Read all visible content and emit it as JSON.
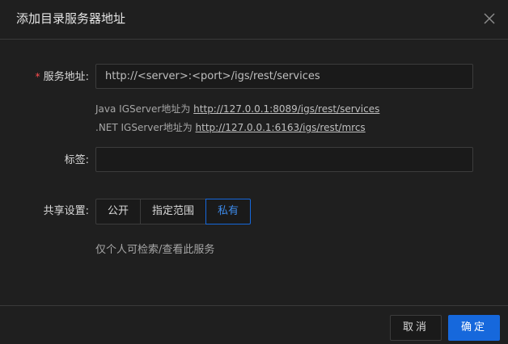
{
  "dialog": {
    "title": "添加目录服务器地址",
    "close_icon": "close-icon"
  },
  "form": {
    "service_address": {
      "required_mark": "*",
      "label": "服务地址:",
      "value": "http://<server>:<port>/igs/rest/services"
    },
    "hints": {
      "java_prefix": "Java IGServer地址为 ",
      "java_url": "http://127.0.0.1:8089/igs/rest/services",
      "net_prefix": ".NET IGServer地址为 ",
      "net_url": "http://127.0.0.1:6163/igs/rest/mrcs"
    },
    "tag": {
      "label": "标签:",
      "value": ""
    },
    "share": {
      "label": "共享设置:",
      "options": [
        "公开",
        "指定范围",
        "私有"
      ],
      "selected": "私有",
      "description": "仅个人可检索/查看此服务"
    }
  },
  "footer": {
    "cancel_label": "取消",
    "ok_label": "确定"
  },
  "colors": {
    "background": "#1f1f1f",
    "primary": "#1668dc",
    "required": "#ff4d4f"
  }
}
